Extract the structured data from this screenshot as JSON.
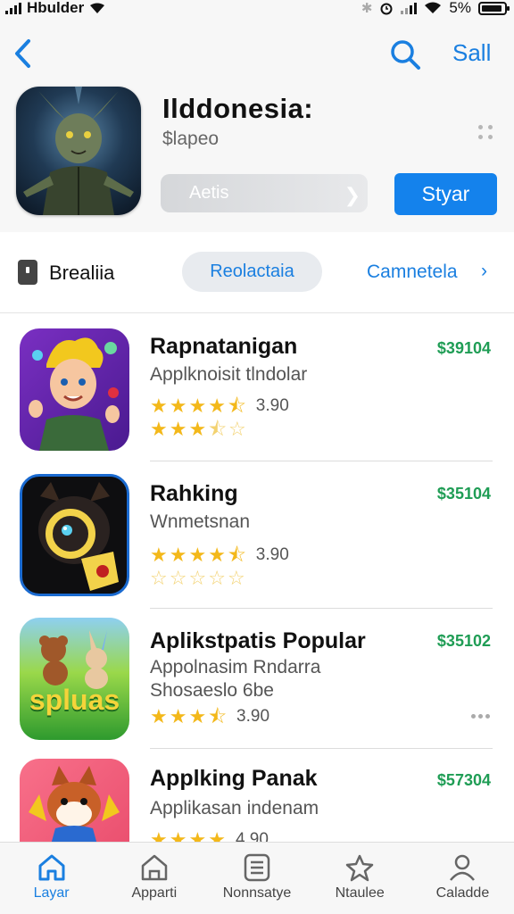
{
  "status_bar": {
    "carrier": "Hbulder",
    "battery_text": "5%"
  },
  "header": {
    "action_label": "Sall",
    "app_title": "Ilddonesia:",
    "app_subtitle": "$lapeo",
    "secondary_button": "Aetis",
    "primary_button": "Styar"
  },
  "filter_row": {
    "label": "Brealiia",
    "pill_label": "Reolactaia",
    "link_label": "Camnetela"
  },
  "list": [
    {
      "title": "Rapnatanigan",
      "price": "$39104",
      "subtitle": "Applknoisit tlndolar",
      "subtitle2": "",
      "rating": "3.90",
      "stars": 4.5
    },
    {
      "title": "Rahking",
      "price": "$35104",
      "subtitle": "Wnmetsnan",
      "subtitle2": "",
      "rating": "3.90",
      "stars": 4.5
    },
    {
      "title": "Aplikstpatis Popular",
      "price": "$35102",
      "subtitle": "Appolnasim Rndarra",
      "subtitle2": "Shosaeslo 6be",
      "rating": "3.90",
      "stars": 3.5,
      "icon_text": "spluas"
    },
    {
      "title": "Applking Panak",
      "price": "$57304",
      "subtitle": "Applikasan indenam",
      "subtitle2": "",
      "rating": "4.90",
      "stars": 4
    }
  ],
  "tabs": [
    {
      "label": "Layar",
      "icon": "home-icon",
      "active": true
    },
    {
      "label": "Apparti",
      "icon": "store-icon",
      "active": false
    },
    {
      "label": "Nonnsatye",
      "icon": "list-icon",
      "active": false
    },
    {
      "label": "Ntaulee",
      "icon": "star-icon",
      "active": false
    },
    {
      "label": "Caladde",
      "icon": "person-icon",
      "active": false
    }
  ],
  "colors": {
    "accent": "#1482ec",
    "price": "#1f9d55",
    "star": "#f3b81a"
  }
}
